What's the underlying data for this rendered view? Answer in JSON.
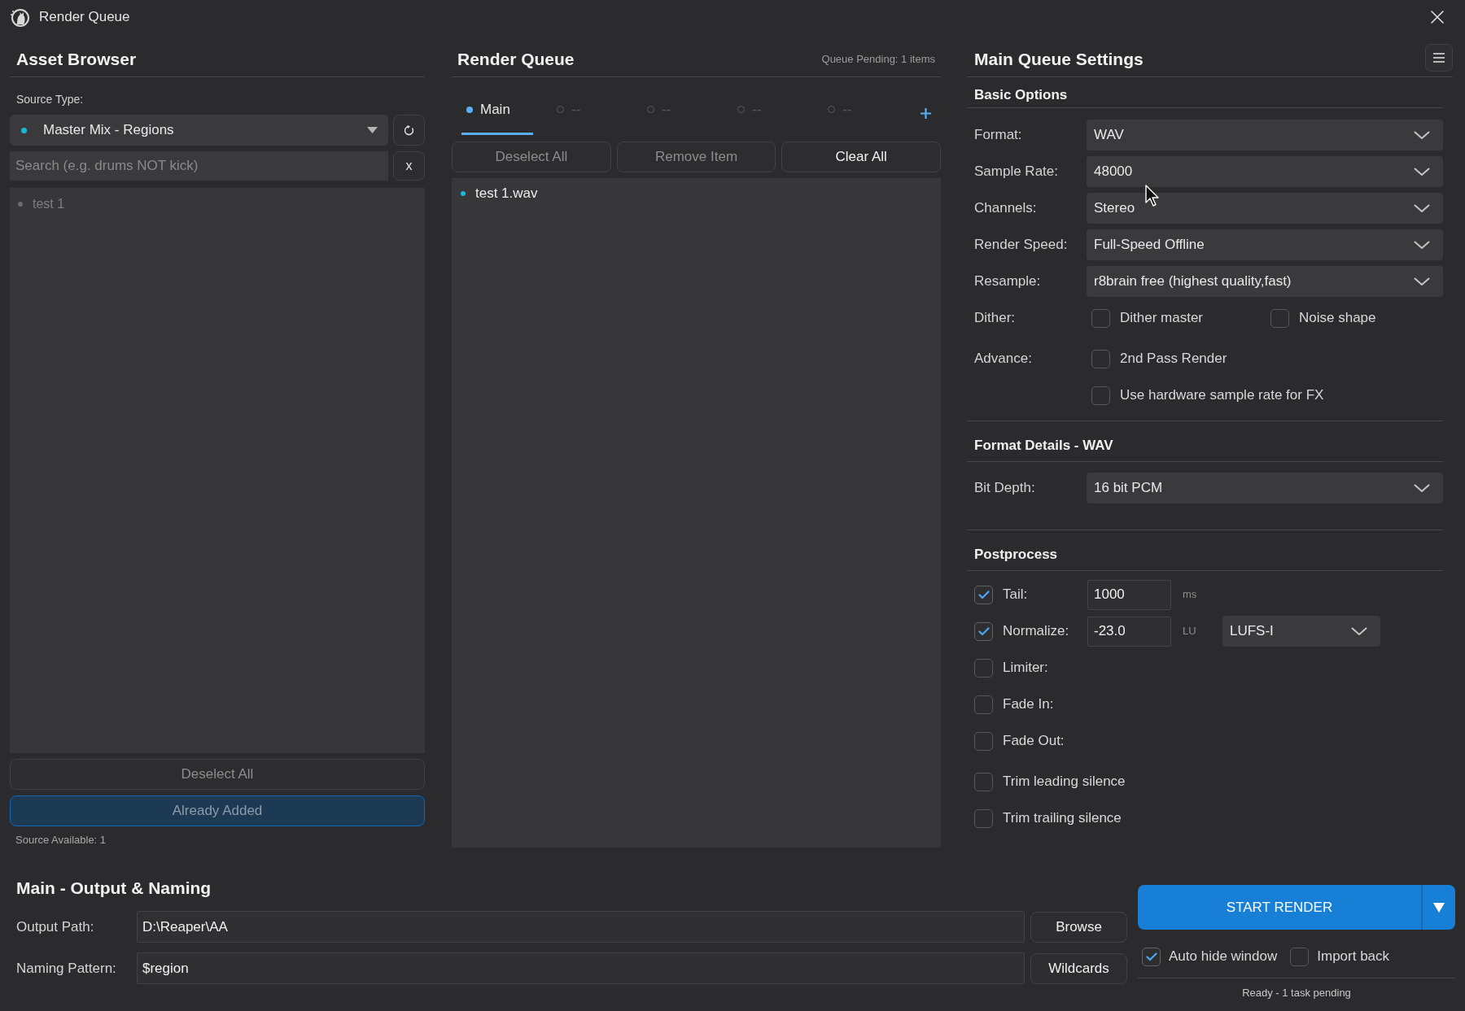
{
  "window": {
    "title": "Render Queue"
  },
  "asset_browser": {
    "title": "Asset Browser",
    "source_type": {
      "label": "Source Type:",
      "value": "Master Mix - Regions"
    },
    "search": {
      "placeholder": "Search (e.g. drums NOT kick)",
      "clear_button": "x"
    },
    "items": [
      {
        "label": "test 1",
        "disabled": true
      }
    ],
    "buttons": [
      {
        "label": "Deselect All",
        "kind": "outline",
        "disabled": true
      },
      {
        "label": "Already Added",
        "kind": "primary",
        "disabled": true
      }
    ],
    "status": "Source Available: 1"
  },
  "render_queue": {
    "title": "Render Queue",
    "pending": "Queue Pending: 1 items",
    "tabs": [
      {
        "label": "Main",
        "selected": true
      },
      {
        "label": "--",
        "selected": false
      },
      {
        "label": "--",
        "selected": false
      },
      {
        "label": "--",
        "selected": false
      },
      {
        "label": "--",
        "selected": false
      }
    ],
    "buttons": [
      {
        "label": "Deselect All",
        "disabled": true
      },
      {
        "label": "Remove Item",
        "disabled": true
      },
      {
        "label": "Clear All",
        "disabled": false
      }
    ],
    "items": [
      {
        "label": "test 1.wav"
      }
    ]
  },
  "settings": {
    "title": "Main Queue Settings",
    "sections": [
      {
        "title": "Basic Options",
        "groups": [
          [
            {
              "kind": "select",
              "label": "Format:",
              "value": "WAV"
            },
            {
              "kind": "select",
              "label": "Sample Rate:",
              "value": "48000"
            },
            {
              "kind": "select",
              "label": "Channels:",
              "value": "Stereo"
            },
            {
              "kind": "select",
              "label": "Render Speed:",
              "value": "Full-Speed Offline"
            },
            {
              "kind": "select",
              "label": "Resample:",
              "value": "r8brain free (highest quality,fast)"
            },
            {
              "kind": "options",
              "label": "Dither:",
              "options": [
                {
                  "label": "Dither master",
                  "checked": false
                },
                {
                  "label": "Noise shape",
                  "checked": false
                }
              ]
            }
          ],
          [
            {
              "kind": "options",
              "label": "Advance:",
              "options": [
                {
                  "label": "2nd Pass Render",
                  "checked": false
                }
              ]
            },
            {
              "kind": "options",
              "options": [
                {
                  "label": "Use hardware sample rate for FX",
                  "checked": false
                }
              ]
            }
          ]
        ]
      },
      {
        "title": "Format Details - WAV",
        "groups": [
          [
            {
              "kind": "select",
              "label": "Bit Depth:",
              "value": "16 bit PCM"
            }
          ]
        ]
      },
      {
        "title": "Postprocess",
        "groups": [
          [
            {
              "kind": "toggle_input",
              "label": "Tail:",
              "checked": true,
              "value": "1000",
              "unit": "ms"
            },
            {
              "kind": "toggle_input",
              "label": "Normalize:",
              "checked": true,
              "value": "-23.0",
              "unit": "LU",
              "mode": "LUFS-I"
            },
            {
              "kind": "toggle",
              "label": "Limiter:",
              "checked": false
            },
            {
              "kind": "toggle",
              "label": "Fade In:",
              "checked": false
            },
            {
              "kind": "toggle",
              "label": "Fade Out:",
              "checked": false
            }
          ],
          [
            {
              "kind": "toggle",
              "label": "Trim leading silence",
              "checked": false
            },
            {
              "kind": "toggle",
              "label": "Trim trailing silence",
              "checked": false
            }
          ]
        ]
      }
    ]
  },
  "output": {
    "title": "Main - Output & Naming",
    "fields": [
      {
        "label": "Output Path:",
        "value": "D:\\Reaper\\AA",
        "button": "Browse"
      },
      {
        "label": "Naming Pattern:",
        "value": "$region",
        "button": "Wildcards"
      }
    ]
  },
  "render": {
    "button": "START RENDER",
    "options": [
      {
        "label": "Auto hide window",
        "checked": true
      },
      {
        "label": "Import back",
        "checked": false
      }
    ],
    "status": "Ready - 1 task pending"
  }
}
